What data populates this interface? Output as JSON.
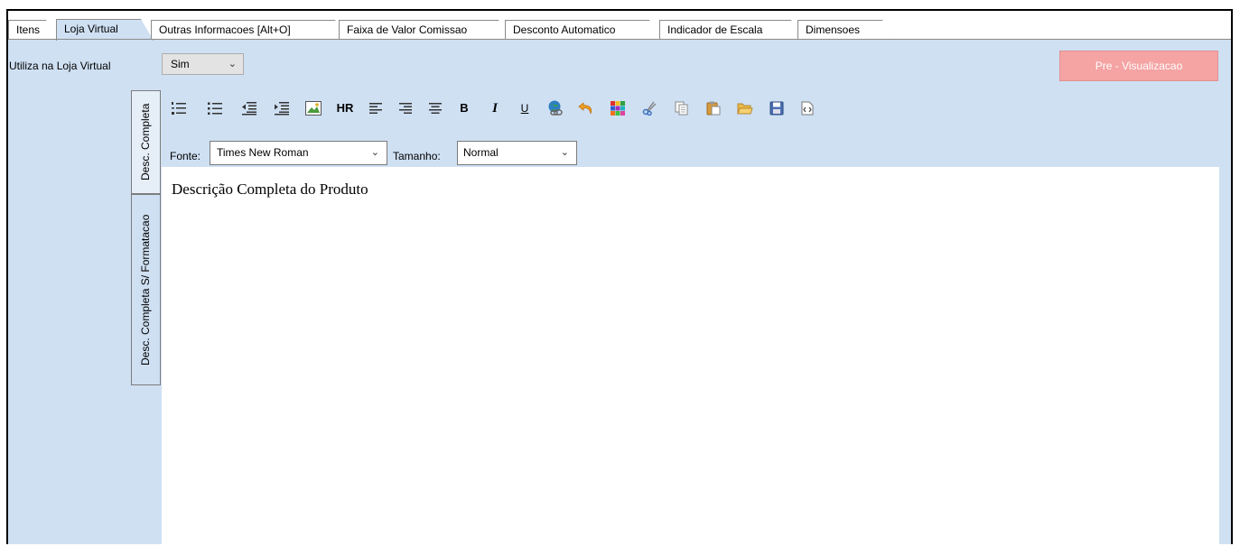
{
  "tabs": [
    {
      "label": "Itens"
    },
    {
      "label": "Loja Virtual"
    },
    {
      "label": "Outras Informacoes [Alt+O]"
    },
    {
      "label": "Faixa de Valor Comissao"
    },
    {
      "label": "Desconto Automatico"
    },
    {
      "label": "Indicador de Escala"
    },
    {
      "label": "Dimensoes"
    }
  ],
  "form": {
    "utiliza_label": "Utiliza na Loja Virtual",
    "utiliza_value": "Sim",
    "preview_button": "Pre - Visualizacao"
  },
  "side_tabs": [
    {
      "label": "Desc. Completa"
    },
    {
      "label": "Desc. Completa S/ Formatacao"
    }
  ],
  "toolbar": {
    "icons": [
      "numbered-list-icon",
      "bullet-list-icon",
      "outdent-icon",
      "indent-icon",
      "insert-image-icon",
      "horizontal-rule-icon",
      "align-left-icon",
      "align-right-icon",
      "align-center-icon",
      "bold-icon",
      "italic-icon",
      "underline-icon",
      "insert-link-icon",
      "undo-icon",
      "color-palette-icon",
      "cut-icon",
      "copy-icon",
      "paste-icon",
      "open-folder-icon",
      "save-icon",
      "html-source-icon"
    ],
    "hr_text": "HR",
    "bold_text": "B",
    "italic_text": "I",
    "underline_text": "U"
  },
  "font": {
    "fonte_label": "Fonte:",
    "fonte_value": "Times New Roman",
    "tamanho_label": "Tamanho:",
    "tamanho_value": "Normal"
  },
  "editor": {
    "content": "Descrição Completa do Produto"
  }
}
